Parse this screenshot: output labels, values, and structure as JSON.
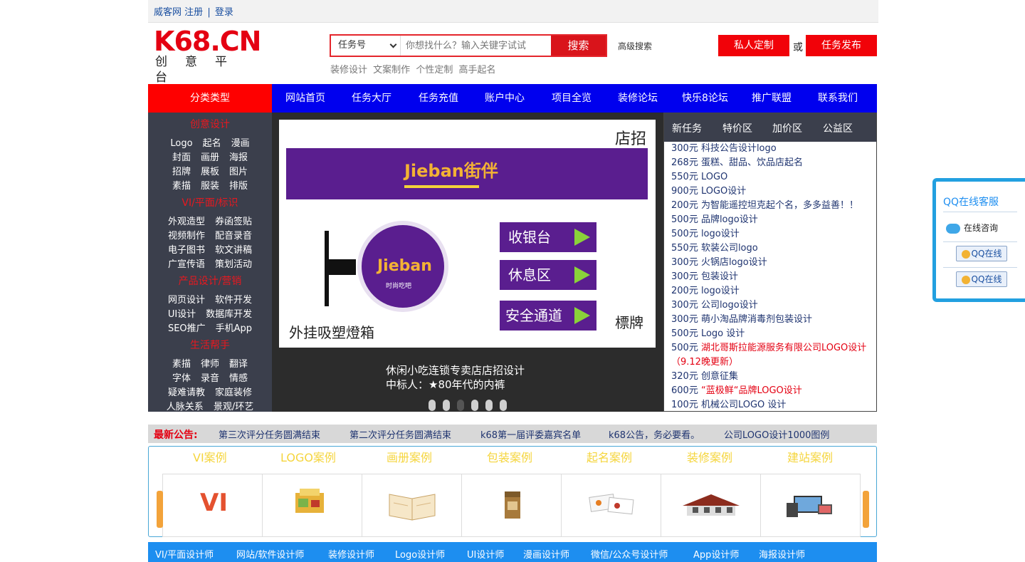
{
  "topbar": {
    "site": "威客网",
    "register": "注册",
    "sep": "|",
    "login": "登录"
  },
  "logo": {
    "main": "K68.CN",
    "sub": "创意平台"
  },
  "search": {
    "select_value": "任务号",
    "placeholder": "你想找什么？输入关键字试试",
    "button": "搜索",
    "advanced": "高级搜索",
    "hot": [
      "装修设计",
      "文案制作",
      "个性定制",
      "高手起名"
    ]
  },
  "header_actions": {
    "custom": "私人定制",
    "or": "或",
    "publish": "任务发布"
  },
  "nav": {
    "category": "分类类型",
    "items": [
      "网站首页",
      "任务大厅",
      "任务充值",
      "账户中心",
      "项目全览",
      "装修论坛",
      "快乐8论坛",
      "推广联盟",
      "联系我们"
    ]
  },
  "sidebar": {
    "groups": [
      {
        "title": "创意设计",
        "rows": [
          [
            "Logo",
            "起名",
            "漫画"
          ],
          [
            "封面",
            "画册",
            "海报"
          ],
          [
            "招牌",
            "展板",
            "图片"
          ],
          [
            "素描",
            "服装",
            "排版"
          ]
        ]
      },
      {
        "title": "VI/平面/标识",
        "rows": [
          [
            "外观造型",
            "券函签贴"
          ],
          [
            "视频制作",
            "配音录音"
          ],
          [
            "电子图书",
            "软文讲稿"
          ],
          [
            "广宣传语",
            "策划活动"
          ]
        ]
      },
      {
        "title": "产品设计/营销",
        "rows": [
          [
            "网页设计",
            "软件开发"
          ],
          [
            "UI设计",
            "数据库开发"
          ],
          [
            "SEO推广",
            "手机App"
          ]
        ]
      },
      {
        "title": "生活帮手",
        "rows": [
          [
            "素描",
            "律师",
            "翻译"
          ],
          [
            "字体",
            "录音",
            "情感"
          ],
          [
            "疑难请教",
            "家庭装修"
          ],
          [
            "人脉关系",
            "景观/环艺"
          ]
        ]
      }
    ]
  },
  "banner": {
    "sign_label": "店招",
    "brand": "Jieban街伴",
    "brand_circle": "Jieban",
    "brand_circle_sub": "时尚吃吧",
    "lightbox_label": "外挂吸塑燈箱",
    "board_label": "標牌",
    "signs": [
      "收银台",
      "休息区",
      "安全通道"
    ],
    "caption_line1": "休闲小吃连锁专卖店店招设计",
    "caption_line2": "中标人：★80年代的内裤",
    "active_dot": 3
  },
  "tasks": {
    "tabs": [
      "新任务",
      "特价区",
      "加价区",
      "公益区"
    ],
    "items": [
      {
        "text": "300元 科技公告设计logo",
        "red": false
      },
      {
        "text": "268元 蛋糕、甜品、饮品店起名",
        "red": false
      },
      {
        "text": "550元 LOGO",
        "red": false
      },
      {
        "text": "900元 LOGO设计",
        "red": false
      },
      {
        "text": "200元 为智能遥控坦克起个名，多多益善！！",
        "red": false
      },
      {
        "text": "500元 品牌logo设计",
        "red": false
      },
      {
        "text": "500元 logo设计",
        "red": false
      },
      {
        "text": "550元 软装公司logo",
        "red": false
      },
      {
        "text": "300元 火锅店logo设计",
        "red": false
      },
      {
        "text": "300元 包装设计",
        "red": false
      },
      {
        "text": "200元 logo设计",
        "red": false
      },
      {
        "text": "300元 公司logo设计",
        "red": false
      },
      {
        "text": "300元 萌小淘品牌消毒剂包装设计",
        "red": false
      },
      {
        "text": "500元 Logo 设计",
        "red": false
      },
      {
        "price": "500元",
        "text": "湖北哥斯拉能源服务有限公司LOGO设计（9.12晚更新）",
        "red": true
      },
      {
        "text": "320元 创意征集",
        "red": false
      },
      {
        "price": "600元",
        "text": "“蓝极鲜“品牌LOGO设计",
        "red": true
      },
      {
        "text": "100元 机械公司LOGO 设计",
        "red": false
      }
    ]
  },
  "notice": {
    "title": "最新公告:",
    "items": [
      "第三次评分任务圆满结束",
      "第二次评分任务圆满结束",
      "k68第一届评委嘉宾名单",
      "k68公告，务必要看。",
      "公司LOGO设计1000图例"
    ]
  },
  "cases": {
    "titles": [
      "VI案例",
      "LOGO案例",
      "画册案例",
      "包装案例",
      "起名案例",
      "装修案例",
      "建站案例"
    ],
    "vi_text": "VI"
  },
  "designers": [
    "VI/平面设计师",
    "网站/软件设计师",
    "装修设计师",
    "Logo设计师",
    "UI设计师",
    "漫画设计师",
    "微信/公众号设计师",
    "App设计师",
    "海报设计师"
  ],
  "qq": {
    "title": "QQ在线客服",
    "consult": "在线咨询",
    "btn1": "QQ在线",
    "btn2": "QQ在线"
  },
  "colors": {
    "brand_red": "#e40012",
    "nav_blue": "#0000ee",
    "sidebar_dark": "#3b3f4c",
    "case_yellow": "#f5d53d",
    "bottom_blue": "#1d8ef0"
  }
}
